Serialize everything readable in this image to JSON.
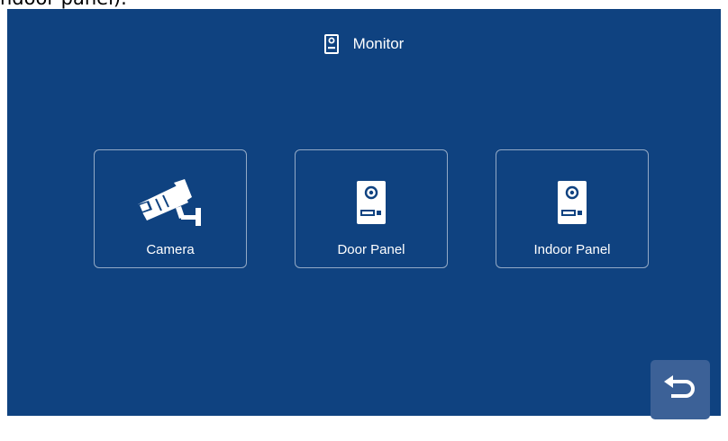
{
  "top_caption": "ndoor panel).",
  "header": {
    "title": "Monitor",
    "icon": "door-panel-icon"
  },
  "tiles": [
    {
      "label": "Camera",
      "icon": "cctv-camera-icon"
    },
    {
      "label": "Door Panel",
      "icon": "door-panel-icon"
    },
    {
      "label": "Indoor Panel",
      "icon": "indoor-panel-icon"
    }
  ],
  "back_button": {
    "icon": "back-arrow-icon"
  },
  "colors": {
    "background": "#0f4280",
    "tile_border": "#8aa1c0",
    "back_button": "#3c6197",
    "text": "#ffffff"
  }
}
